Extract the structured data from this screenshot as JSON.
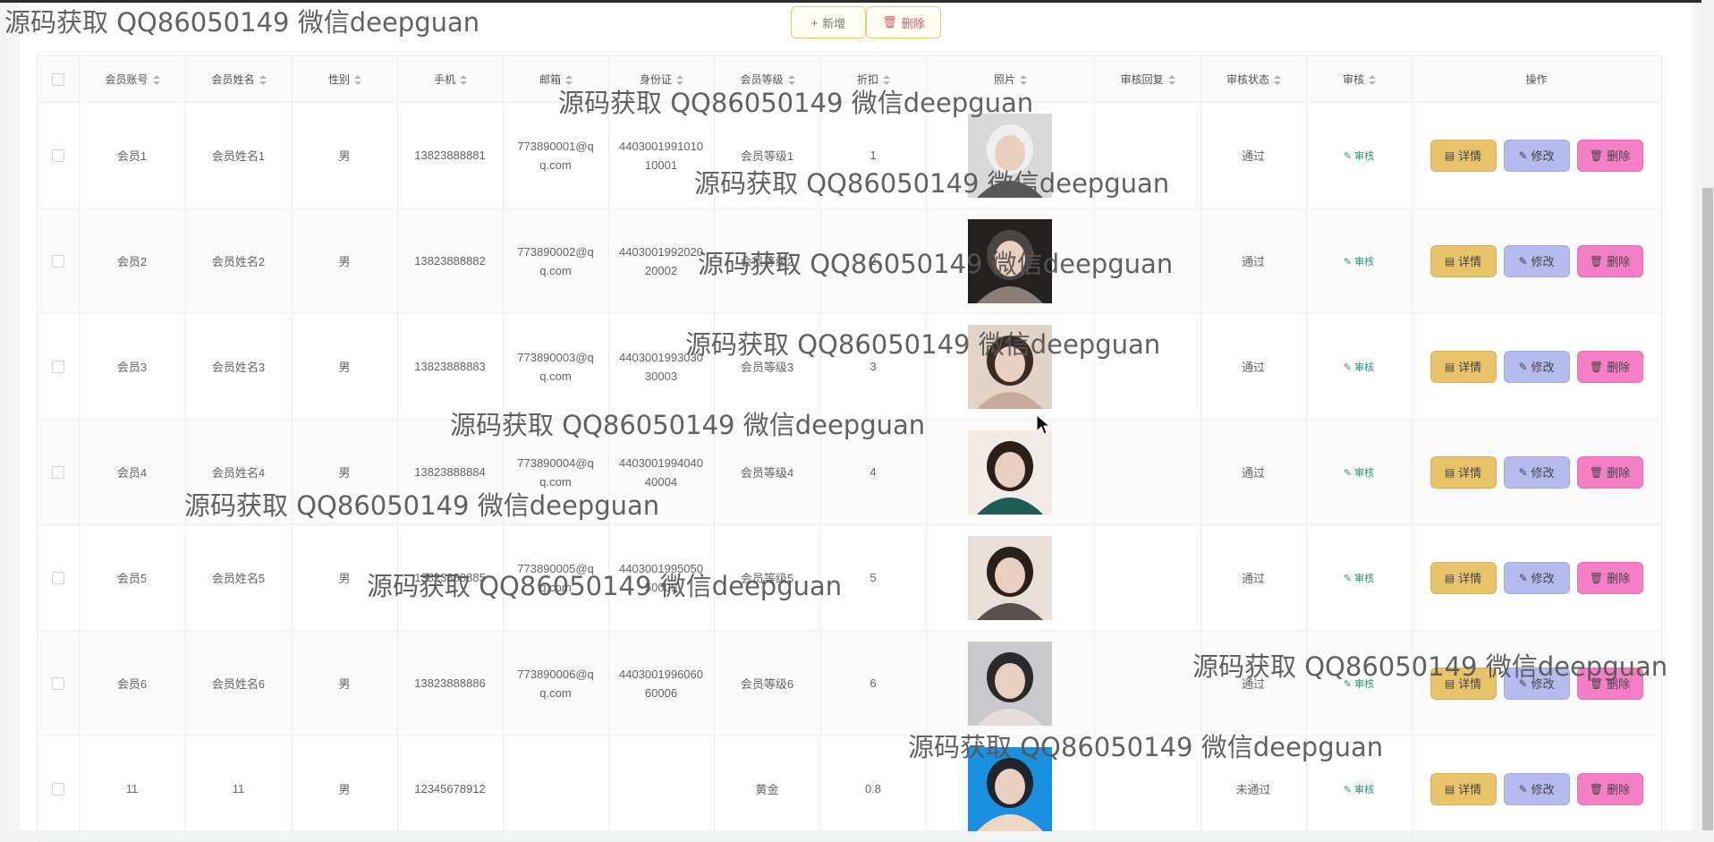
{
  "toolbar": {
    "add_label": "新增",
    "delete_label": "删除",
    "add_icon": "plus-icon",
    "delete_icon": "trash-icon"
  },
  "table": {
    "columns": [
      "会员账号",
      "会员姓名",
      "性别",
      "手机",
      "邮箱",
      "身份证",
      "会员等级",
      "折扣",
      "照片",
      "审核回复",
      "审核状态",
      "审核",
      "操作"
    ],
    "rows": [
      {
        "account": "会员1",
        "name": "会员姓名1",
        "gender": "男",
        "phone": "13823888881",
        "email": "773890001@qq.com",
        "idcard": "440300199101010001",
        "level": "会员等级1",
        "discount": "1",
        "reply": "",
        "status": "通过",
        "audit": "审核",
        "photo_colors": [
          "#d9d9d9",
          "#efefef",
          "#585858"
        ]
      },
      {
        "account": "会员2",
        "name": "会员姓名2",
        "gender": "男",
        "phone": "13823888882",
        "email": "773890002@qq.com",
        "idcard": "440300199202020002",
        "level": "会员等级2",
        "discount": "2",
        "reply": "",
        "status": "通过",
        "audit": "审核",
        "photo_colors": [
          "#23201f",
          "#4b4442",
          "#8a7d75"
        ]
      },
      {
        "account": "会员3",
        "name": "会员姓名3",
        "gender": "男",
        "phone": "13823888883",
        "email": "773890003@qq.com",
        "idcard": "440300199303030003",
        "level": "会员等级3",
        "discount": "3",
        "reply": "",
        "status": "通过",
        "audit": "审核",
        "photo_colors": [
          "#e2d3c8",
          "#3b2b25",
          "#c8aa98"
        ]
      },
      {
        "account": "会员4",
        "name": "会员姓名4",
        "gender": "男",
        "phone": "13823888884",
        "email": "773890004@qq.com",
        "idcard": "440300199404040004",
        "level": "会员等级4",
        "discount": "4",
        "reply": "",
        "status": "通过",
        "audit": "审核",
        "photo_colors": [
          "#f2ece8",
          "#2c1f1a",
          "#1f5c54"
        ]
      },
      {
        "account": "会员5",
        "name": "会员姓名5",
        "gender": "男",
        "phone": "13823888885",
        "email": "773890005@qq.com",
        "idcard": "440300199505050005",
        "level": "会员等级5",
        "discount": "5",
        "reply": "",
        "status": "通过",
        "audit": "审核",
        "photo_colors": [
          "#eadfd8",
          "#2a1f1b",
          "#5a5050"
        ]
      },
      {
        "account": "会员6",
        "name": "会员姓名6",
        "gender": "男",
        "phone": "13823888886",
        "email": "773890006@qq.com",
        "idcard": "440300199606060006",
        "level": "会员等级6",
        "discount": "6",
        "reply": "",
        "status": "通过",
        "audit": "审核",
        "photo_colors": [
          "#c9c9cb",
          "#2a2a2c",
          "#e3dedc"
        ]
      },
      {
        "account": "11",
        "name": "11",
        "gender": "男",
        "phone": "12345678912",
        "email": "",
        "idcard": "",
        "level": "黄金",
        "discount": "0.8",
        "reply": "",
        "status": "未通过",
        "audit": "审核",
        "photo_colors": [
          "#1b8fe0",
          "#20242b",
          "#f0d7c4"
        ]
      }
    ],
    "ops": {
      "detail": "详情",
      "edit": "修改",
      "delete": "删除"
    }
  },
  "watermarks": [
    "源码获取 QQ86050149 微信deepguan"
  ]
}
